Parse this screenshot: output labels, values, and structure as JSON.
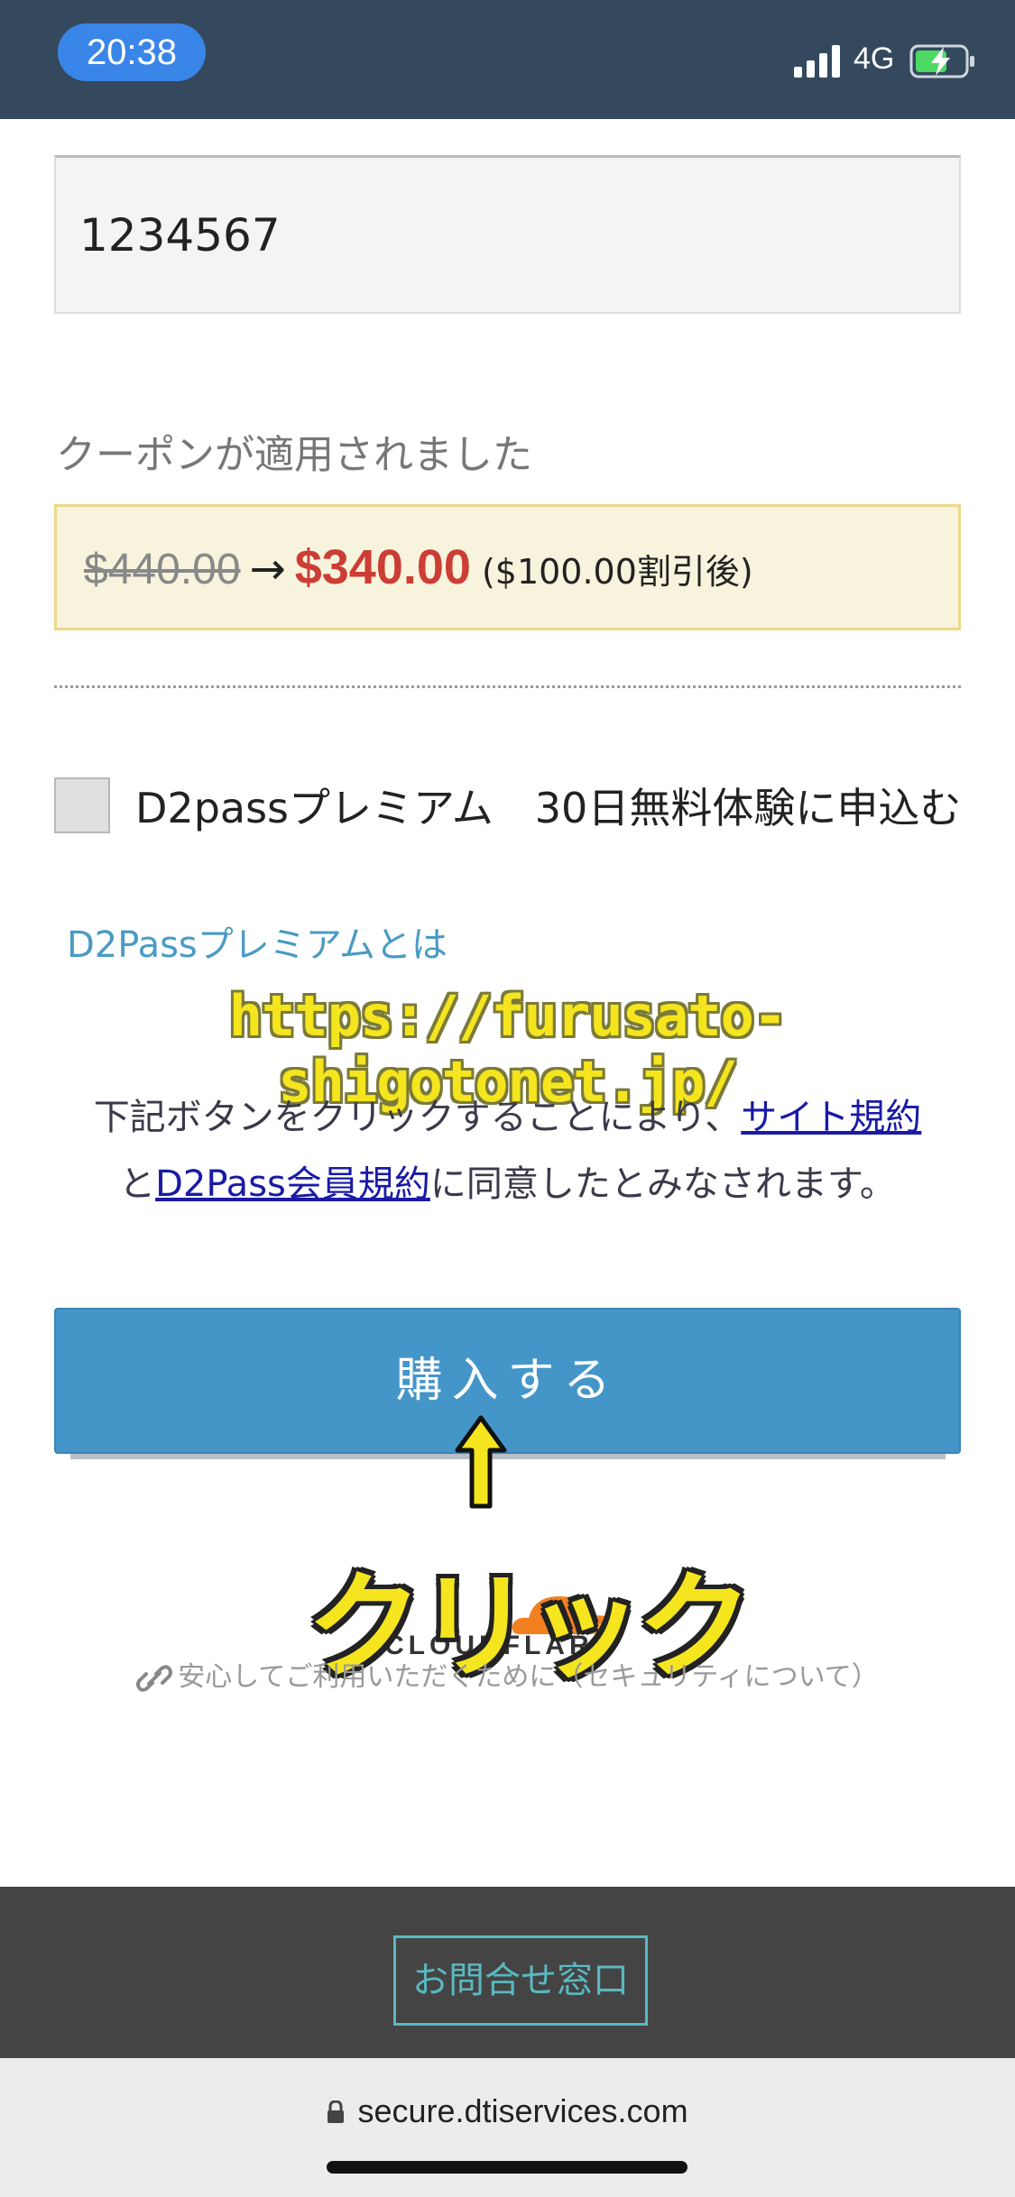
{
  "status_bar": {
    "time": "20:38",
    "network": "4G",
    "icons": [
      "signal-icon",
      "battery-charging-icon"
    ]
  },
  "form": {
    "coupon_code_value": "1234567",
    "coupon_applied_label": "クーポンが適用されました",
    "old_price": "$440.00",
    "arrow": "→",
    "new_price": "$340.00",
    "discount_note": "($100.00割引後)",
    "premium_checkbox_label": "D2passプレミアム　30日無料体験に申込む",
    "premium_checked": false,
    "premium_info_link": "D2Passプレミアムとは"
  },
  "watermark": "https://furusato-shigotonet.jp/",
  "agreement": {
    "text_1": "下記ボタンをクリックすることにより、",
    "site_terms_link": "サイト規約",
    "text_2": "と",
    "member_terms_link": "D2Pass会員規約",
    "text_3": "に同意したとみなされます。"
  },
  "buy_button_label": "購入する",
  "annotation": {
    "click_label": "クリック",
    "icons": [
      "up-arrow-icon"
    ]
  },
  "cloudflare": {
    "logo_text": "CLOUDFLARE",
    "security_link": "安心してご利用いただくために（セキュリティについて）",
    "icons": [
      "cloudflare-cloud-icon",
      "link-icon"
    ]
  },
  "footer": {
    "contact_button": "お問合せ窓口"
  },
  "browser": {
    "url": "secure.dtiservices.com",
    "icons": [
      "lock-icon"
    ]
  },
  "colors": {
    "status_bar_bg": "#34495e",
    "time_pill": "#3a86e8",
    "new_price": "#cc3d35",
    "price_box_bg": "#f7f3dc",
    "buy_button": "#4496c8",
    "link_blue": "#1a1aa6",
    "premium_link": "#4a9bc4",
    "annotation_yellow": "#f5e51e",
    "footer_bg": "#444444",
    "contact_teal": "#5ab8c0"
  }
}
